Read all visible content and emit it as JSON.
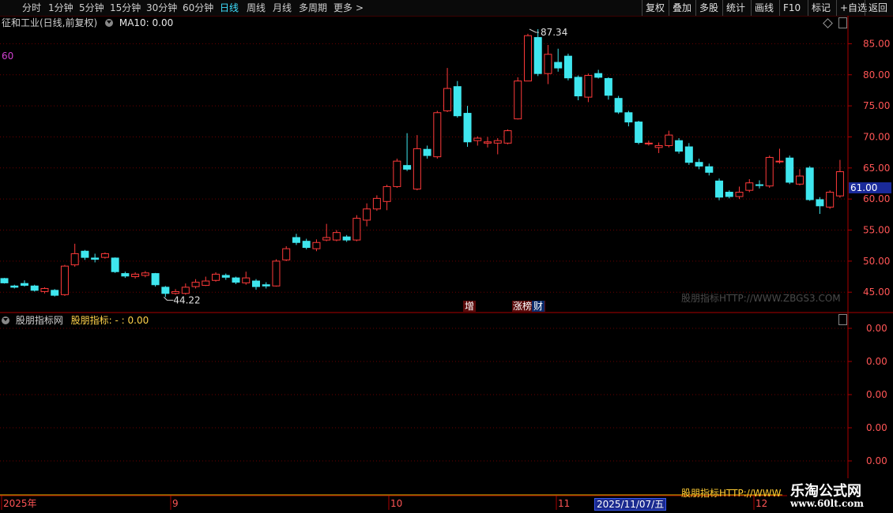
{
  "toolbar": {
    "left": [
      {
        "label": "分时",
        "x": 28
      },
      {
        "label": "1分钟",
        "x": 61
      },
      {
        "label": "5分钟",
        "x": 100
      },
      {
        "label": "15分钟",
        "x": 139
      },
      {
        "label": "30分钟",
        "x": 185
      },
      {
        "label": "60分钟",
        "x": 231
      },
      {
        "label": "日线",
        "x": 278,
        "active": true
      },
      {
        "label": "周线",
        "x": 312
      },
      {
        "label": "月线",
        "x": 345
      },
      {
        "label": "多周期",
        "x": 378
      },
      {
        "label": "更多",
        "x": 422
      }
    ],
    "more_arrow": ">",
    "right": [
      "复权",
      "叠加",
      "多股",
      "统计",
      "画线",
      "F10",
      "标记",
      "+自选",
      "返回"
    ]
  },
  "chart_title": "征和工业(日线,前复权)",
  "ma_label": "MA10: 0.00",
  "level_label": "60",
  "indicator": {
    "name": "股朋指标网",
    "value_label": "股朋指标: - : 0.00"
  },
  "watermark": "股朋指标HTTP://WWW.ZBGS3.COM",
  "bottom_watermark": "股朋指标HTTP://WWW",
  "logo": {
    "cn": "乐淘公式网",
    "url": "www.60lt.com"
  },
  "price_tag": "61.00",
  "tags": {
    "zeng": "增",
    "zt": "涨榜",
    "cai": "财"
  },
  "dates": {
    "year": "2025年",
    "m9": "9",
    "m10": "10",
    "m11": "11",
    "highlight": "2025/11/07/五",
    "m12": "12"
  },
  "chart_data": {
    "type": "candlestick",
    "y_ticks": [
      "85.00",
      "80.00",
      "75.00",
      "70.00",
      "65.00",
      "60.00",
      "55.00",
      "50.00",
      "45.00"
    ],
    "y_values": [
      85,
      80,
      75,
      70,
      65,
      60,
      55,
      50,
      45
    ],
    "ylim": [
      41.85,
      89.5
    ],
    "indicator_ticks": [
      "0.00",
      "0.00",
      "0.00",
      "0.00",
      "0.00"
    ],
    "high_annotation": "87.34",
    "low_annotation": "44.22",
    "candles": [
      [
        47.2,
        46.5,
        47.3,
        46.4
      ],
      [
        46.0,
        45.8,
        46.2,
        45.6
      ],
      [
        46.4,
        46.1,
        46.9,
        45.9
      ],
      [
        46.0,
        45.3,
        46.2,
        45.1
      ],
      [
        45.1,
        45.6,
        45.8,
        44.8
      ],
      [
        45.3,
        44.5,
        45.5,
        44.3
      ],
      [
        44.6,
        49.2,
        49.4,
        44.4
      ],
      [
        49.4,
        51.2,
        52.8,
        49.1
      ],
      [
        51.6,
        50.6,
        51.8,
        50.2
      ],
      [
        50.5,
        50.3,
        51.2,
        49.8
      ],
      [
        50.6,
        51.2,
        51.4,
        50.4
      ],
      [
        50.5,
        48.3,
        50.6,
        48.1
      ],
      [
        48.0,
        47.6,
        48.3,
        47.3
      ],
      [
        47.5,
        47.9,
        48.2,
        47.2
      ],
      [
        47.7,
        48.1,
        48.4,
        47.4
      ],
      [
        48.0,
        46.2,
        48.1,
        45.9
      ],
      [
        45.8,
        44.8,
        46.0,
        44.22
      ],
      [
        44.8,
        45.1,
        45.5,
        44.6
      ],
      [
        44.8,
        45.8,
        46.4,
        44.6
      ],
      [
        45.9,
        46.6,
        47.1,
        45.6
      ],
      [
        46.1,
        46.8,
        47.5,
        46.0
      ],
      [
        46.9,
        47.9,
        48.2,
        46.7
      ],
      [
        47.7,
        47.4,
        48.0,
        47.0
      ],
      [
        47.3,
        46.6,
        47.5,
        46.3
      ],
      [
        46.5,
        47.3,
        48.3,
        46.2
      ],
      [
        46.8,
        45.9,
        47.1,
        45.4
      ],
      [
        46.2,
        46.0,
        46.6,
        45.6
      ],
      [
        46.0,
        50.0,
        50.3,
        45.9
      ],
      [
        50.2,
        52.0,
        52.4,
        50.0
      ],
      [
        53.8,
        53.0,
        54.4,
        52.6
      ],
      [
        53.2,
        52.2,
        53.6,
        51.9
      ],
      [
        52.0,
        53.0,
        53.5,
        51.6
      ],
      [
        53.4,
        53.8,
        56.0,
        53.2
      ],
      [
        53.4,
        54.6,
        55.0,
        53.2
      ],
      [
        53.9,
        53.4,
        54.2,
        53.1
      ],
      [
        53.4,
        56.9,
        57.4,
        53.2
      ],
      [
        56.6,
        58.4,
        59.3,
        55.6
      ],
      [
        58.4,
        60.1,
        60.6,
        58.1
      ],
      [
        59.6,
        62.0,
        62.3,
        58.2
      ],
      [
        62.0,
        66.1,
        66.5,
        61.8
      ],
      [
        65.4,
        64.8,
        70.6,
        64.5
      ],
      [
        61.6,
        68.1,
        70.3,
        61.4
      ],
      [
        68.0,
        67.0,
        68.6,
        66.5
      ],
      [
        66.8,
        73.9,
        74.2,
        66.5
      ],
      [
        74.2,
        77.8,
        81.1,
        74.0
      ],
      [
        78.1,
        73.4,
        79.0,
        73.1
      ],
      [
        73.8,
        69.2,
        75.0,
        68.4
      ],
      [
        69.4,
        69.8,
        70.1,
        68.6
      ],
      [
        69.0,
        69.2,
        70.0,
        68.3
      ],
      [
        69.0,
        69.4,
        69.8,
        67.2
      ],
      [
        69.0,
        71.0,
        71.2,
        68.8
      ],
      [
        72.9,
        79.0,
        79.6,
        72.8
      ],
      [
        79.0,
        86.3,
        86.6,
        79.0
      ],
      [
        86.0,
        80.2,
        87.34,
        79.8
      ],
      [
        80.2,
        83.3,
        84.8,
        78.5
      ],
      [
        82.0,
        81.1,
        84.2,
        80.5
      ],
      [
        83.0,
        79.5,
        83.4,
        79.1
      ],
      [
        79.6,
        76.6,
        79.9,
        75.9
      ],
      [
        76.4,
        79.9,
        80.2,
        75.6
      ],
      [
        80.2,
        79.6,
        80.8,
        79.4
      ],
      [
        79.4,
        76.7,
        79.6,
        76.0
      ],
      [
        76.2,
        74.0,
        76.6,
        73.7
      ],
      [
        73.9,
        72.4,
        74.2,
        71.7
      ],
      [
        72.4,
        69.1,
        72.6,
        68.8
      ],
      [
        68.9,
        69.0,
        69.4,
        68.6
      ],
      [
        68.3,
        68.6,
        69.1,
        67.4
      ],
      [
        68.6,
        70.3,
        71.0,
        68.3
      ],
      [
        69.4,
        67.7,
        69.8,
        67.3
      ],
      [
        68.4,
        65.9,
        69.0,
        65.5
      ],
      [
        65.9,
        65.3,
        66.5,
        64.8
      ],
      [
        65.2,
        64.3,
        65.7,
        63.8
      ],
      [
        62.9,
        60.3,
        63.3,
        59.8
      ],
      [
        61.1,
        60.4,
        61.4,
        60.1
      ],
      [
        60.4,
        61.1,
        62.0,
        60.0
      ],
      [
        61.4,
        62.6,
        63.2,
        61.1
      ],
      [
        62.3,
        62.2,
        63.0,
        61.7
      ],
      [
        62.1,
        66.7,
        67.0,
        61.8
      ],
      [
        66.0,
        66.1,
        68.1,
        65.7
      ],
      [
        66.6,
        62.7,
        67.0,
        62.4
      ],
      [
        62.4,
        63.7,
        64.8,
        62.2
      ],
      [
        65.0,
        59.9,
        65.3,
        59.7
      ],
      [
        59.9,
        58.9,
        60.3,
        57.6
      ],
      [
        58.7,
        61.1,
        61.4,
        58.4
      ],
      [
        60.5,
        64.4,
        66.3,
        60.2
      ]
    ]
  }
}
